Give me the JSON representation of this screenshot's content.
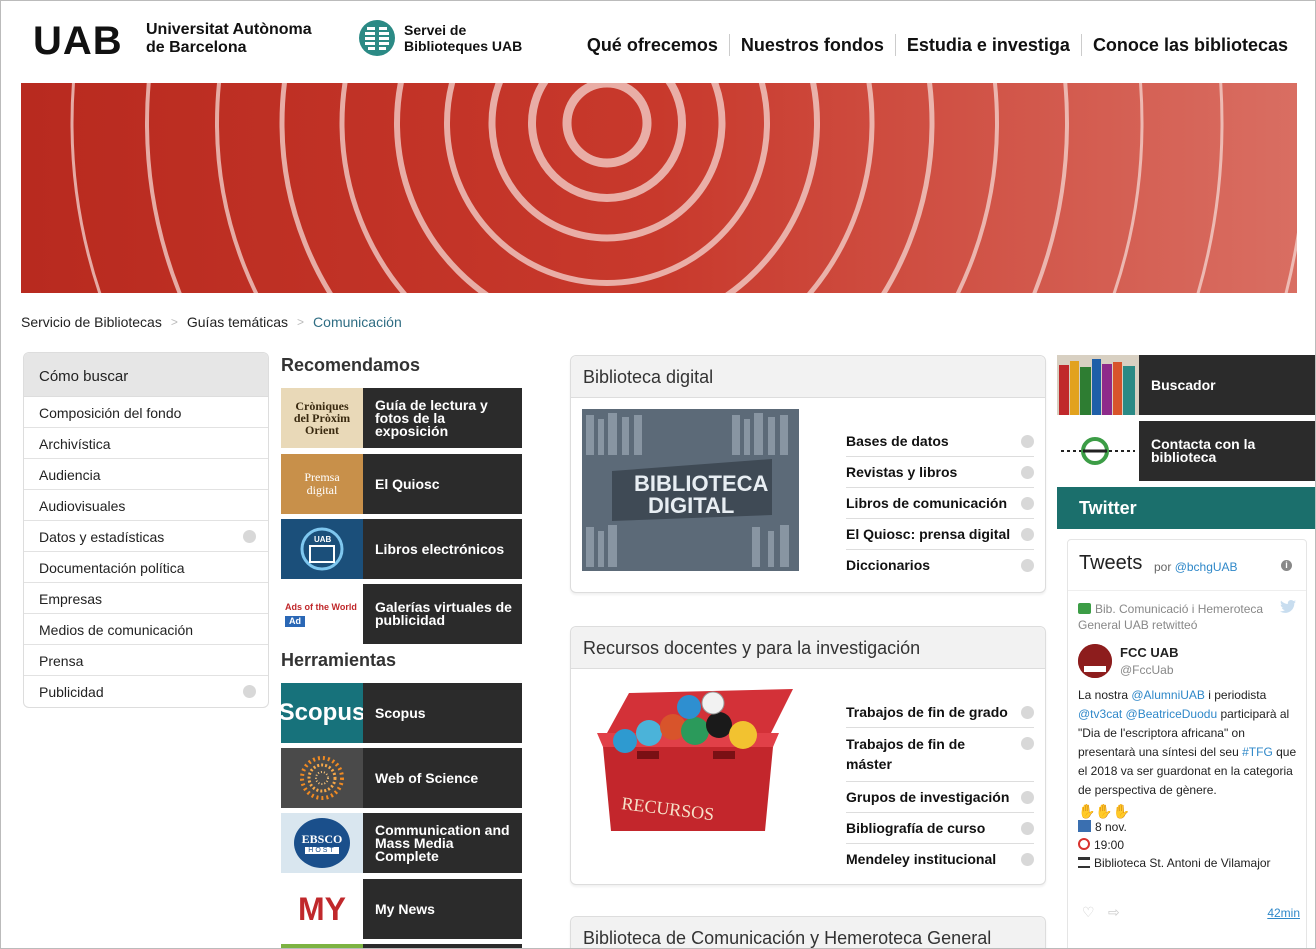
{
  "header": {
    "uab_logo": "UAB",
    "uab_name_line1": "Universitat Autònoma",
    "uab_name_line2": "de Barcelona",
    "sbu_line1": "Servei de",
    "sbu_line2": "Biblioteques UAB",
    "nav": [
      "Qué ofrecemos",
      "Nuestros fondos",
      "Estudia e investiga",
      "Conoce las bibliotecas"
    ]
  },
  "breadcrumb": {
    "items": [
      "Servicio de Bibliotecas",
      "Guías temáticas",
      "Comunicación"
    ]
  },
  "leftmenu": {
    "title": "Cómo buscar",
    "items": [
      "Composición del fondo",
      "Archivística",
      "Audiencia",
      "Audiovisuales",
      "Datos y estadísticas",
      "Documentación política",
      "Empresas",
      "Medios de comunicación",
      "Prensa",
      "Publicidad"
    ]
  },
  "recomendamos": {
    "title": "Recomendamos",
    "tiles": [
      {
        "label": "Guía de lectura y fotos de la exposición",
        "thumb_text_1": "Cròniques",
        "thumb_text_2": "del Pròxim",
        "thumb_text_3": "Orient"
      },
      {
        "label": "El Quiosc",
        "thumb_text_1": "Premsa",
        "thumb_text_2": "digital"
      },
      {
        "label": "Libros electrónicos",
        "thumb_text_1": "UAB"
      },
      {
        "label": "Galerías virtuales de publicidad",
        "thumb_text_1": "Ads of the World",
        "thumb_text_2": "Ad"
      }
    ]
  },
  "herramientas": {
    "title": "Herramientas",
    "tiles": [
      {
        "label": "Scopus",
        "thumb_text_1": "Scopus"
      },
      {
        "label": "Web of Science"
      },
      {
        "label": "Communication and Mass Media Complete",
        "thumb_text_1": "EBSCO",
        "thumb_text_2": "HOST"
      },
      {
        "label": "My News",
        "thumb_text_1": "MY"
      }
    ]
  },
  "panels": {
    "digital": {
      "title": "Biblioteca digital",
      "image_text_1": "BIBLIOTECA",
      "image_text_2": "DIGITAL",
      "links": [
        "Bases de datos",
        "Revistas y libros",
        "Libros de comunicación",
        "El Quiosc: prensa digital",
        "Diccionarios"
      ]
    },
    "recursos": {
      "title": "Recursos docentes y para la investigación",
      "image_text": "RECURSOS",
      "links": [
        "Trabajos de fin de grado",
        "Trabajos de fin de máster",
        "Grupos de investigación",
        "Bibliografía de curso",
        "Mendeley institucional"
      ]
    },
    "biblioteca": {
      "title": "Biblioteca de Comunicación y Hemeroteca General"
    }
  },
  "right": {
    "buscador": "Buscador",
    "contacta": "Contacta con la biblioteca",
    "twitter": "Twitter"
  },
  "twitter": {
    "title": "Tweets",
    "by": "por",
    "handle": "@bchgUAB",
    "retweet": "Bib. Comunicació i Hemeroteca General UAB retwitteó",
    "user": "FCC UAB",
    "user_handle": "@FccUab",
    "text_1": "La nostra ",
    "mention_1": "@AlumniUAB",
    "text_2": " i periodista ",
    "mention_2": "@tv3cat",
    "text_3": " ",
    "mention_3": "@BeatriceDuodu",
    "text_4": " participarà al \"Dia de l'escriptora africana\" on presentarà una síntesi del seu ",
    "hashtag": "#TFG",
    "text_5": " que el 2018 va ser guardonat en la categoria de perspectiva de gènere.",
    "date": "8 nov.",
    "time": "19:00",
    "place": "Biblioteca St. Antoni de Vilamajor",
    "age": "42min"
  },
  "colors": {
    "banner_red": "#c63a2c",
    "tile_dark": "#2b2b2b",
    "twitter_teal": "#1b6f6c",
    "link_blue": "#2f88c9",
    "breadcrumb_current": "#2f6d83"
  }
}
